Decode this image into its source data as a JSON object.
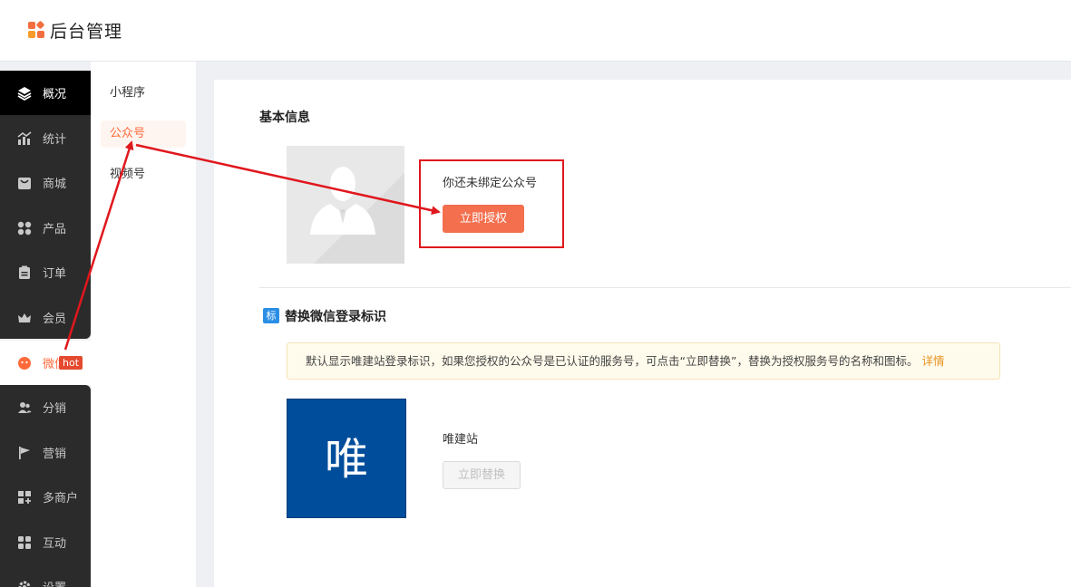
{
  "header": {
    "title": "后台管理"
  },
  "sidebar": {
    "items": [
      {
        "label": "概况",
        "icon": "layers-icon"
      },
      {
        "label": "统计",
        "icon": "chart-icon"
      },
      {
        "label": "商城",
        "icon": "store-icon"
      },
      {
        "label": "产品",
        "icon": "grid-icon"
      },
      {
        "label": "订单",
        "icon": "clipboard-icon"
      },
      {
        "label": "会员",
        "icon": "crown-icon"
      },
      {
        "label": "微信",
        "icon": "wechat-icon"
      },
      {
        "label": "分销",
        "icon": "users-icon"
      },
      {
        "label": "营销",
        "icon": "flag-icon"
      },
      {
        "label": "多商户",
        "icon": "shop-plus-icon"
      },
      {
        "label": "互动",
        "icon": "grid2-icon"
      },
      {
        "label": "设置",
        "icon": "gear-icon"
      }
    ],
    "hot_badge": "hot"
  },
  "subnav": {
    "items": [
      {
        "label": "小程序"
      },
      {
        "label": "公众号"
      },
      {
        "label": "视频号"
      }
    ]
  },
  "main": {
    "basic_title": "基本信息",
    "unbound_text": "你还未绑定公众号",
    "auth_button": "立即授权",
    "tag_icon_text": "标",
    "replace_title": "替换微信登录标识",
    "notice_text": "默认显示唯建站登录标识，如果您授权的公众号是已认证的服务号，可点击“立即替换”，替换为授权服务号的名称和图标。",
    "notice_link": "详情",
    "logo_char": "唯",
    "site_name": "唯建站",
    "replace_button": "立即替换"
  },
  "colors": {
    "accent": "#ff6a3a",
    "sidebar_bg": "#2b2b2b",
    "annotation_red": "#e0171d",
    "logo_blue": "#004e9b"
  }
}
